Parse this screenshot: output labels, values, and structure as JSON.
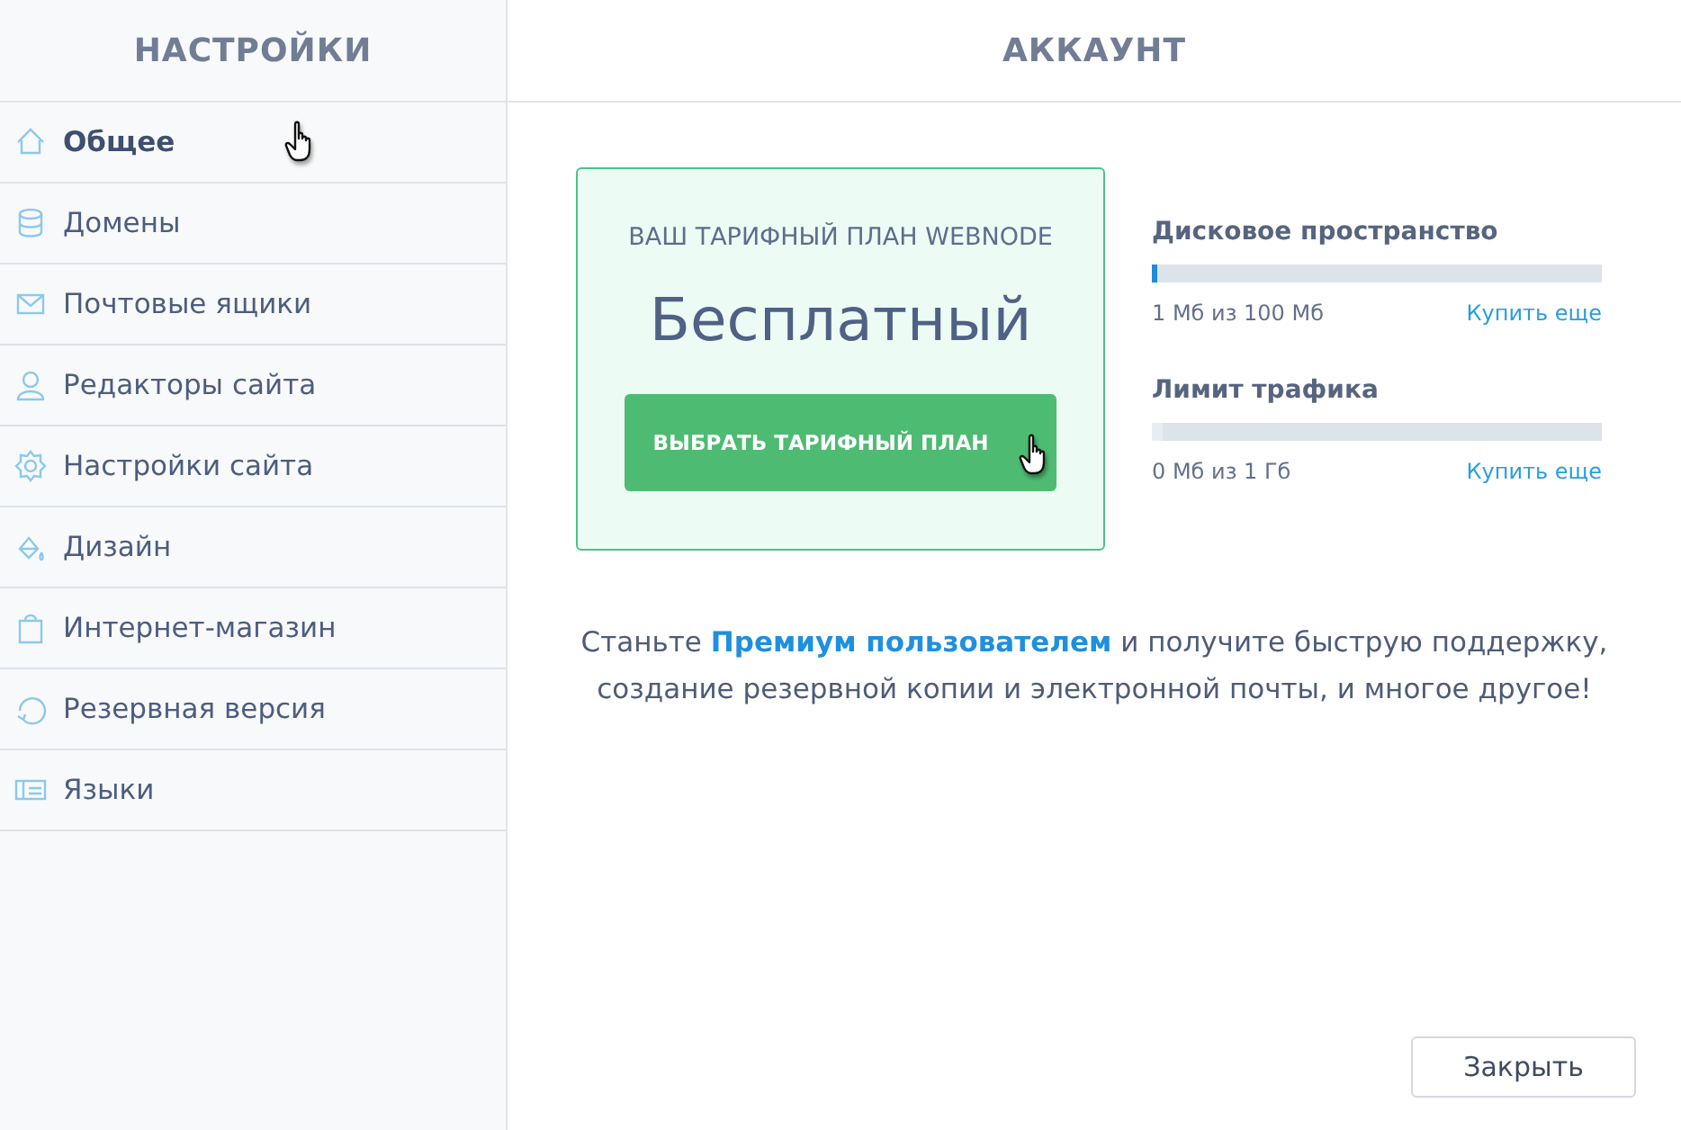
{
  "sidebar": {
    "title": "НАСТРОЙКИ",
    "items": [
      {
        "label": "Общее",
        "selected": true
      },
      {
        "label": "Домены",
        "selected": false
      },
      {
        "label": "Почтовые ящики",
        "selected": false
      },
      {
        "label": "Редакторы сайта",
        "selected": false
      },
      {
        "label": "Настройки сайта",
        "selected": false
      },
      {
        "label": "Дизайн",
        "selected": false
      },
      {
        "label": "Интернет-магазин",
        "selected": false
      },
      {
        "label": "Резервная версия",
        "selected": false
      },
      {
        "label": "Языки",
        "selected": false
      }
    ]
  },
  "main": {
    "title": "АККАУНТ",
    "plan": {
      "caption": "ВАШ ТАРИФНЫЙ ПЛАН WEBNODE",
      "name": "Бесплатный",
      "button": "ВЫБРАТЬ ТАРИФНЫЙ ПЛАН"
    },
    "meters": [
      {
        "title": "Дисковое пространство",
        "level": 0.01,
        "reading": "1 Мб из 100 Мб",
        "link": "Купить еще"
      },
      {
        "title": "Лимит трафика",
        "level": 0,
        "reading": "0 Мб из 1 Гб",
        "link": "Купить еще"
      }
    ],
    "promo": "Станьте **Премиум пользователем** и получите быструю поддержку, создание резервной копии и электронной почты, и многое другое!",
    "close_button": "Закрыть"
  }
}
